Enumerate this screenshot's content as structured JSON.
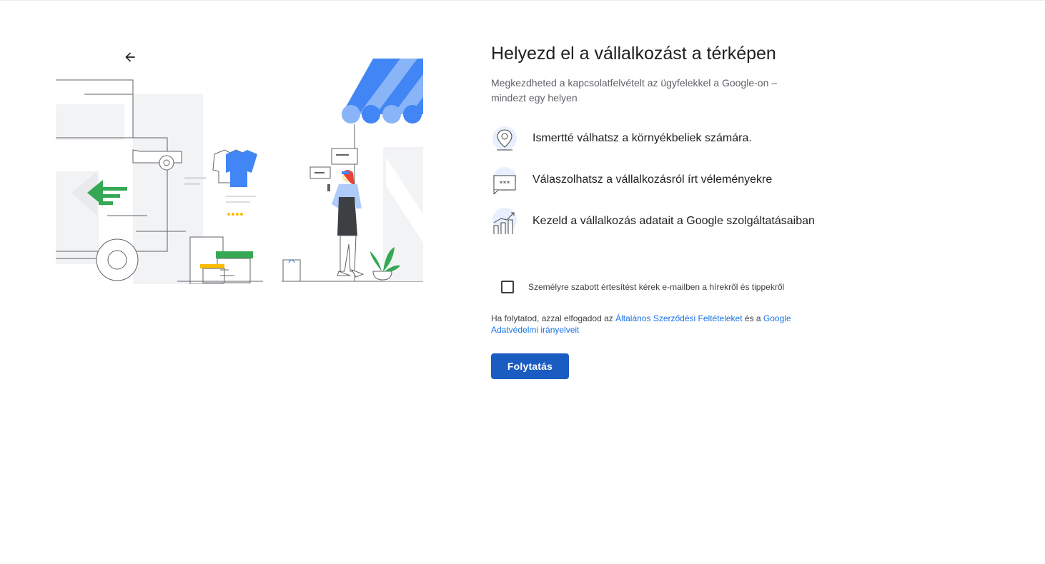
{
  "header": {
    "title": "Helyezd el a vállalkozást a térképen",
    "subtitle": "Megkezdheted a kapcsolatfelvételt az ügyfelekkel a Google-on – mindezt egy helyen"
  },
  "features": [
    {
      "icon": "location-pin-icon",
      "text": "Ismertté válhatsz a környékbeliek számára."
    },
    {
      "icon": "review-stars-icon",
      "text": "Válaszolhatsz a vállalkozásról írt véleményekre"
    },
    {
      "icon": "growth-chart-icon",
      "text": "Kezeld a vállalkozás adatait a Google szolgáltatásaiban"
    }
  ],
  "opt_in": {
    "label": "Személyre szabott értesítést kérek e-mailben a hírekről és tippekről",
    "checked": false
  },
  "terms": {
    "prefix": "Ha folytatod, azzal elfogadod az ",
    "tos_link": "Általános Szerződési Feltételeket",
    "middle": " és a ",
    "privacy_link": "Google Adatvédelmi irányelveit"
  },
  "actions": {
    "continue_label": "Folytatás"
  },
  "colors": {
    "primary_button": "#1a5cc2",
    "link": "#1a73e8",
    "awning_blue": "#4285f4",
    "awning_light": "#8ab4f8",
    "accent_green": "#34a853"
  }
}
